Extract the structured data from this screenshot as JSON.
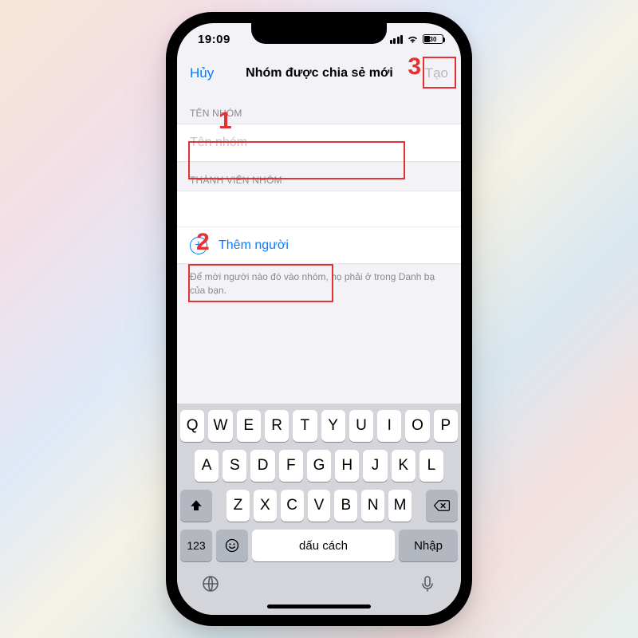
{
  "statusbar": {
    "time": "19:09",
    "battery_pct": "30"
  },
  "nav": {
    "cancel": "Hủy",
    "title": "Nhóm được chia sẻ mới",
    "create": "Tạo"
  },
  "sections": {
    "group_name_label": "TÊN NHÓM",
    "group_name_placeholder": "Tên nhóm",
    "members_label": "THÀNH VIÊN NHÓM",
    "add_people": "Thêm người",
    "hint": "Để mời người nào đó vào nhóm, họ phải ở trong Danh bạ của bạn."
  },
  "keyboard": {
    "row1": [
      "Q",
      "W",
      "E",
      "R",
      "T",
      "Y",
      "U",
      "I",
      "O",
      "P"
    ],
    "row2": [
      "A",
      "S",
      "D",
      "F",
      "G",
      "H",
      "J",
      "K",
      "L"
    ],
    "row3": [
      "Z",
      "X",
      "C",
      "V",
      "B",
      "N",
      "M"
    ],
    "k123": "123",
    "space": "dấu cách",
    "return": "Nhập"
  },
  "annotations": {
    "one": "1",
    "two": "2",
    "three": "3"
  }
}
